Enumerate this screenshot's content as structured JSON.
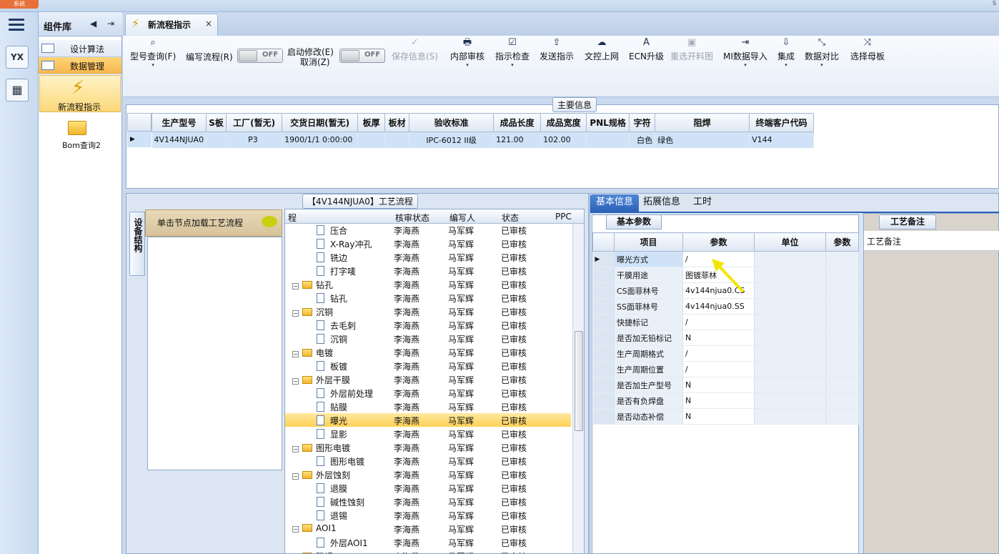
{
  "app": {
    "app_tab": "系统",
    "corner": "S"
  },
  "component_library": {
    "title": "组件库",
    "items": [
      {
        "label": "设计算法"
      },
      {
        "label": "数据管理"
      }
    ],
    "big_button": "新流程指示",
    "bom": "Bom查询2"
  },
  "left_icons": [
    "YX",
    "calc"
  ],
  "doc_tab": {
    "label": "新流程指示"
  },
  "toolbar": {
    "items": [
      {
        "label": "型号查询(F)",
        "icon": "search-icon",
        "dropdown": "▾"
      },
      {
        "label": "编写流程(R)",
        "icon": "",
        "dropdown": ""
      },
      {
        "label": "启动修改(E)",
        "label2": "取消(Z)"
      },
      {
        "label": "保存信息(S)",
        "icon": "✓",
        "disabled": true
      },
      {
        "label": "内部审核",
        "icon": "🖶",
        "dropdown": "▾"
      },
      {
        "label": "指示检查",
        "icon": "☑",
        "dropdown": "▾"
      },
      {
        "label": "发送指示",
        "icon": "⇪"
      },
      {
        "label": "文控上网",
        "icon": "☁"
      },
      {
        "label": "ECN升级",
        "icon": "A"
      },
      {
        "label": "重选开料图",
        "icon": "▣",
        "disabled": true
      },
      {
        "label": "MI数据导入",
        "icon": "⇥",
        "dropdown": "▾"
      },
      {
        "label": "集成",
        "icon": "⇩",
        "dropdown": "▾"
      },
      {
        "label": "数据对比",
        "icon": "⤡",
        "dropdown": "▾"
      },
      {
        "label": "选择母板",
        "icon": "⤨"
      }
    ],
    "toggle_off": "OFF"
  },
  "main_info": {
    "caption": "主要信息",
    "columns": [
      "生产型号",
      "S板",
      "工厂(暂无)",
      "交货日期(暂无)",
      "板厚",
      "板材",
      "验收标准",
      "成品长度",
      "成品宽度",
      "PNL规格",
      "字符",
      "阻焊",
      "终端客户代码"
    ],
    "row": [
      "4V144NJUA0",
      "",
      "P3",
      "1900/1/1 0:00:00",
      "",
      "",
      "IPC-6012 II级",
      "121.00",
      "102.00",
      "",
      "白色",
      "绿色",
      "V144"
    ]
  },
  "flow": {
    "caption": "【4V144NJUA0】工艺流程",
    "side_tab": "设备结构",
    "load_hint": "单击节点加载工艺流程",
    "columns": [
      "程",
      "核审状态",
      "编写人",
      "状态",
      "PPC"
    ],
    "rows": [
      {
        "name": "压合",
        "level": 1,
        "reviewer": "李海燕",
        "writer": "马军辉",
        "status": "已审核"
      },
      {
        "name": "X-Ray冲孔",
        "level": 1,
        "reviewer": "李海燕",
        "writer": "马军辉",
        "status": "已审核"
      },
      {
        "name": "铣边",
        "level": 1,
        "reviewer": "李海燕",
        "writer": "马军辉",
        "status": "已审核"
      },
      {
        "name": "打字唛",
        "level": 1,
        "reviewer": "李海燕",
        "writer": "马军辉",
        "status": "已审核"
      },
      {
        "name": "钻孔",
        "level": 0,
        "reviewer": "李海燕",
        "writer": "马军辉",
        "status": "已审核"
      },
      {
        "name": "钻孔",
        "level": 1,
        "reviewer": "李海燕",
        "writer": "马军辉",
        "status": "已审核"
      },
      {
        "name": "沉铜",
        "level": 0,
        "reviewer": "李海燕",
        "writer": "马军辉",
        "status": "已审核"
      },
      {
        "name": "去毛刺",
        "level": 1,
        "reviewer": "李海燕",
        "writer": "马军辉",
        "status": "已审核"
      },
      {
        "name": "沉铜",
        "level": 1,
        "reviewer": "李海燕",
        "writer": "马军辉",
        "status": "已审核"
      },
      {
        "name": "电镀",
        "level": 0,
        "reviewer": "李海燕",
        "writer": "马军辉",
        "status": "已审核"
      },
      {
        "name": "板镀",
        "level": 1,
        "reviewer": "李海燕",
        "writer": "马军辉",
        "status": "已审核"
      },
      {
        "name": "外层干膜",
        "level": 0,
        "reviewer": "李海燕",
        "writer": "马军辉",
        "status": "已审核"
      },
      {
        "name": "外层前处理",
        "level": 1,
        "reviewer": "李海燕",
        "writer": "马军辉",
        "status": "已审核"
      },
      {
        "name": "贴膜",
        "level": 1,
        "reviewer": "李海燕",
        "writer": "马军辉",
        "status": "已审核"
      },
      {
        "name": "曝光",
        "level": 1,
        "reviewer": "李海燕",
        "writer": "马军辉",
        "status": "已审核",
        "highlight": true
      },
      {
        "name": "显影",
        "level": 1,
        "reviewer": "李海燕",
        "writer": "马军辉",
        "status": "已审核"
      },
      {
        "name": "图形电镀",
        "level": 0,
        "reviewer": "李海燕",
        "writer": "马军辉",
        "status": "已审核"
      },
      {
        "name": "图形电镀",
        "level": 1,
        "reviewer": "李海燕",
        "writer": "马军辉",
        "status": "已审核"
      },
      {
        "name": "外层蚀刻",
        "level": 0,
        "reviewer": "李海燕",
        "writer": "马军辉",
        "status": "已审核"
      },
      {
        "name": "退膜",
        "level": 1,
        "reviewer": "李海燕",
        "writer": "马军辉",
        "status": "已审核"
      },
      {
        "name": "碱性蚀刻",
        "level": 1,
        "reviewer": "李海燕",
        "writer": "马军辉",
        "status": "已审核"
      },
      {
        "name": "退锡",
        "level": 1,
        "reviewer": "李海燕",
        "writer": "马军辉",
        "status": "已审核"
      },
      {
        "name": "AOI1",
        "level": 0,
        "reviewer": "李海燕",
        "writer": "马军辉",
        "status": "已审核"
      },
      {
        "name": "外层AOI1",
        "level": 1,
        "reviewer": "李海燕",
        "writer": "马军辉",
        "status": "已审核"
      },
      {
        "name": "阻焊",
        "level": 0,
        "reviewer": "李海燕",
        "writer": "马军辉",
        "status": "已审核"
      }
    ]
  },
  "detail": {
    "tabs": [
      "基本信息",
      "拓展信息",
      "工时"
    ],
    "sub_caption": "基本参数",
    "columns": [
      "项目",
      "参数",
      "单位",
      "参数"
    ],
    "rows": [
      {
        "item": "曝光方式",
        "param": "/"
      },
      {
        "item": "干膜用途",
        "param": "图镀菲林"
      },
      {
        "item": "CS面菲林号",
        "param": "4v144njua0.CS"
      },
      {
        "item": "SS面菲林号",
        "param": "4v144njua0.SS"
      },
      {
        "item": "快捷标记",
        "param": "/"
      },
      {
        "item": "是否加无铅标记",
        "param": "N"
      },
      {
        "item": "生产周期格式",
        "param": "/"
      },
      {
        "item": "生产周期位置",
        "param": "/"
      },
      {
        "item": "是否加生产型号",
        "param": "N"
      },
      {
        "item": "是否有负焊盘",
        "param": "N"
      },
      {
        "item": "是否动态补偿",
        "param": "N"
      }
    ]
  },
  "remarks": {
    "caption": "工艺备注",
    "label": "工艺备注"
  },
  "colors": {
    "accent": "#e8703a",
    "highlight": "#ffd056",
    "selection": "#cfe2f8"
  }
}
